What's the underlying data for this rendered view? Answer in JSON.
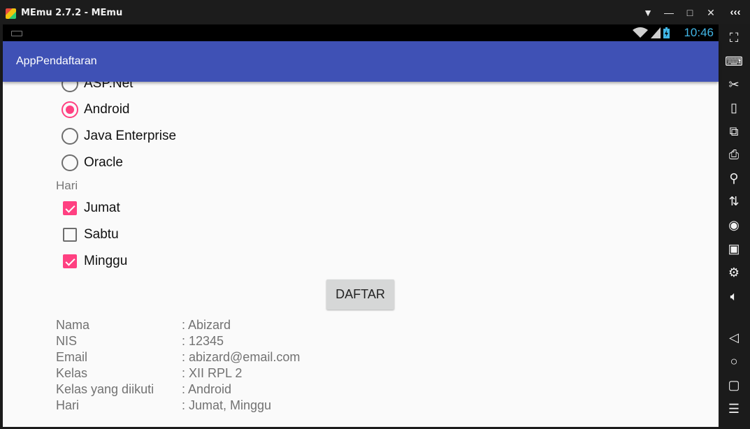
{
  "window": {
    "title": "MEmu 2.7.2 - MEmu",
    "controls": [
      "▼",
      "—",
      "□",
      "✕"
    ],
    "collapse_label": "‹‹‹"
  },
  "statusbar": {
    "time": "10:46"
  },
  "appbar": {
    "title": "AppPendaftaran"
  },
  "courses": [
    {
      "label": "ASP.Net",
      "selected": false
    },
    {
      "label": "Android",
      "selected": true
    },
    {
      "label": "Java Enterprise",
      "selected": false
    },
    {
      "label": "Oracle",
      "selected": false
    }
  ],
  "days_section_label": "Hari",
  "days": [
    {
      "label": "Jumat",
      "checked": true
    },
    {
      "label": "Sabtu",
      "checked": false
    },
    {
      "label": "Minggu",
      "checked": true
    }
  ],
  "submit_label": "DAFTAR",
  "summary": [
    {
      "key": "Nama",
      "value": ": Abizard"
    },
    {
      "key": "NIS",
      "value": ": 12345"
    },
    {
      "key": "Email",
      "value": ": abizard@email.com"
    },
    {
      "key": "Kelas",
      "value": ": XII RPL 2"
    },
    {
      "key": "Kelas yang diikuti",
      "value": ": Android"
    },
    {
      "key": "Hari",
      "value": ": Jumat, Minggu"
    }
  ],
  "sidebar_icons": [
    "fullscreen-icon",
    "keyboard-icon",
    "scissors-icon",
    "shake-icon",
    "rotate-icon",
    "apk-install-icon",
    "broom-icon",
    "shared-folder-icon",
    "mouse-icon",
    "screen-record-icon",
    "settings-icon",
    "volume-icon",
    "back-icon",
    "home-icon",
    "recent-apps-icon",
    "menu-icon"
  ]
}
